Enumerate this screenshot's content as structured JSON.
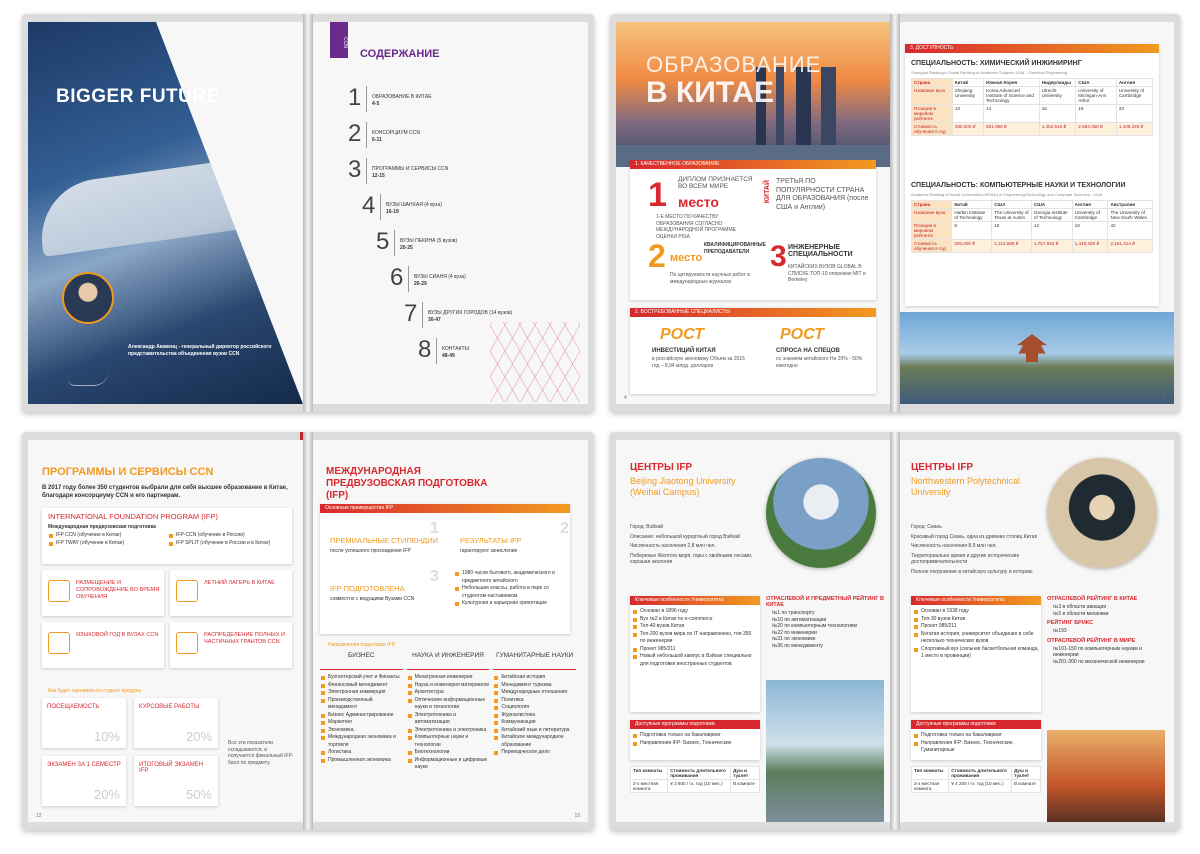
{
  "spread1": {
    "cover_title": "BIGGER FUTURE",
    "cover_small": "CCN",
    "contents_title": "СОДЕРЖАНИЕ",
    "toc": [
      {
        "n": "1",
        "title": "ОБРАЗОВАНИЕ В КИТАЕ",
        "pages": "4-5"
      },
      {
        "n": "2",
        "title": "КОНСОРЦИУМ CCN",
        "pages": "6-11"
      },
      {
        "n": "3",
        "title": "ПРОГРАММЫ И СЕРВИСЫ CCN",
        "pages": "12-15"
      },
      {
        "n": "4",
        "title": "ВУЗЫ ШАНХАЯ (4 вуза)",
        "pages": "16-19"
      },
      {
        "n": "5",
        "title": "ВУЗЫ ПЕКИНА (5 вузов)",
        "pages": "20-25"
      },
      {
        "n": "6",
        "title": "ВУЗЫ СИАНЯ (4 вуза)",
        "pages": "26-29"
      },
      {
        "n": "7",
        "title": "ВУЗЫ ДРУГИХ ГОРОДОВ (14 вузов)",
        "pages": "30-47"
      },
      {
        "n": "8",
        "title": "КОНТАКТЫ",
        "pages": "48-49"
      }
    ],
    "author": "Александр Акавенц - генеральный директор российского представительства объединения вузов CCN"
  },
  "spread2": {
    "hero_line1": "ОБРАЗОВАНИЕ",
    "hero_line2": "В КИТАЕ",
    "sec1": "1. КАЧЕСТВЕННОЕ ОБРАЗОВАНИЕ",
    "f1_big": "1",
    "f1_word": "место",
    "f1_top": "ДИПЛОМ ПРИЗНАЕТСЯ ВО ВСЕМ МИРЕ",
    "f1_sub": "1-Е МЕСТО ПО КАЧЕСТВУ ОБРАЗОВАНИЯ СОГЛАСНО МЕЖДУНАРОДНОЙ ПРОГРАММЕ ОЦЕНКИ PISA",
    "f2_side": "КИТАЙ",
    "f2_text": "ТРЕТЬЯ ПО ПОПУЛЯРНОСТИ СТРАНА ДЛЯ ОБРАЗОВАНИЯ (после США и Англии)",
    "f3_big": "2",
    "f3_word": "место",
    "f3_top": "КВАЛИФИЦИРОВАННЫЕ ПРЕПОДАВАТЕЛИ",
    "f3_sub": "По цитируемости научных работ в международных журналах",
    "f4_big": "3",
    "f4_top": "ИНЖЕНЕРНЫЕ СПЕЦИАЛЬНОСТИ",
    "f4_sub": "КИТАЙСКИХ ВУЗОВ GLOBAL В СПИСКЕ ТОП-10 опережая MIT и Berkeley",
    "sec2": "2. ВОСТРЕБОВАННЫЕ СПЕЦИАЛИСТЫ",
    "g1_big": "РОСТ",
    "g1_title": "ИНВЕСТИЦИЙ КИТАЯ",
    "g1_sub": "в российскую экономику Объем за 2015 год – 8,94 млрд. долларов",
    "g2_big": "РОСТ",
    "g2_title": "СПРОСА НА СПЕЦОВ",
    "g2_sub": "со знанием китайского На 20% - 50% ежегодно",
    "sec3": "3. ДОСТУПНОСТЬ",
    "t1_title": "СПЕЦИАЛЬНОСТЬ: ХИМИЧЕСКИЙ ИНЖИНИРИНГ",
    "t1_src": "Shanghai Ranking's Global Ranking of Academic Subjects 2016 - Chemical Engineering",
    "t1_head": [
      "Страна",
      "Китай",
      "Южная Корея",
      "Нидерланды",
      "США",
      "Англия"
    ],
    "t1_rows": [
      [
        "Название вуза",
        "Zhejiang University",
        "Korea Advanced Institute of Science and Technology",
        "Utrecht University",
        "University of Michigan-Ann Arbor",
        "University of Cambridge"
      ],
      [
        "Позиция в мировом рейтинге",
        "13",
        "14",
        "16",
        "19",
        "23"
      ],
      [
        "Стоимость обучения в год",
        "280,000 ₽",
        "501,966 ₽",
        "1,452,519 ₽",
        "2,693,358 ₽",
        "1,449,329 ₽"
      ]
    ],
    "t2_title": "СПЕЦИАЛЬНОСТЬ: КОМПЬЮТЕРНЫЕ НАУКИ И ТЕХНОЛОГИИ",
    "t2_src": "Academic Ranking of World Universities (ARWU) in Engineering/Technology and Computer Sciences - 2016",
    "t2_head": [
      "Страна",
      "Китай",
      "США",
      "США",
      "Англия",
      "Австралия"
    ],
    "t2_rows": [
      [
        "Название вуза",
        "Harbin Institute of Technology",
        "The University of Texas at Austin",
        "Georgia Institute of Technology",
        "University of Cambridge",
        "The University of New South Wales"
      ],
      [
        "Позиция в мировом рейтинге",
        "9",
        "10",
        "12",
        "19",
        "42"
      ],
      [
        "Стоимость обучения в год",
        "200,000 ₽",
        "2,112,966 ₽",
        "1,757,993 ₽",
        "1,449,329 ₽",
        "2,161,414 ₽"
      ]
    ],
    "page_left": "4",
    "page_right": "5"
  },
  "spread3": {
    "title": "ПРОГРАММЫ И СЕРВИСЫ CCN",
    "intro": "В 2017 году более 350 студентов выбрали для себя высшее образование в Китае, благодаря консорциуму CCN и его партнерам.",
    "ifp_title": "INTERNATIONAL FOUNDATION PROGRAM (IFP)",
    "ifp_sub": "Международная предвузовская подготовка",
    "ifp_items": [
      "IFP CCN (обучение в Китае)",
      "IFP-CCN (обучение в России)",
      "IFP TWAY (обучение в Китае)",
      "IFP SPLIT (обучение в России и в Китае)"
    ],
    "svc": [
      "РАЗМЕЩЕНИЕ И СОПРОВОЖДЕНИЕ ВО ВРЕМЯ ОБУЧЕНИЯ",
      "ЛЕТНИЙ ЛАГЕРЬ В КИТАЕ",
      "ЯЗЫКОВОЙ ГОД В ВУЗАХ CCN",
      "РАСПРЕДЕЛЕНИЕ ПОЛНЫХ И ЧАСТИЧНЫХ ГРАНТОВ CCN"
    ],
    "grade_q": "Как будет оцениваться студент предузы",
    "grades": [
      {
        "label": "ПОСЕЩАЕМОСТЬ",
        "pct": "10%"
      },
      {
        "label": "КУРСОВЫЕ РАБОТЫ",
        "pct": "20%"
      },
      {
        "label": "ЭКЗАМЕН ЗА 1 СЕМЕСТР",
        "pct": "20%"
      },
      {
        "label": "ИТОГОВЫЙ ЭКЗАМЕН IFP",
        "pct": "50%"
      }
    ],
    "grade_note": "Все эти показатели складываются, и получается финальный IFP-балл по предмету.",
    "r_title": "МЕЖДУНАРОДНАЯ ПРЕДВУЗОВСКАЯ ПОДГОТОВКА (IFP)",
    "adv_bar": "Основные преимущества IFP",
    "adv": [
      {
        "n": "1",
        "t": "ПРЕМИАЛЬНЫЕ СТИПЕНДИИ",
        "s": "после успешного прохождения IFP"
      },
      {
        "n": "2",
        "t": "РЕЗУЛЬТАТЫ IFP",
        "s": "гарантируют зачисление"
      },
      {
        "n": "3",
        "t": "IFP ПОДГОТОВЛЕНА",
        "s": "совместно с ведущими Вузами CCN"
      }
    ],
    "adv_list": [
      "1080 часов бытового, академического и предметного китайского",
      "Небольшие классы, работа в паре со студентом-наставником",
      "Культурная и карьерная ориентация"
    ],
    "dir_label": "Направления подготовки IFP",
    "cols": [
      {
        "h": "БИЗНЕС",
        "items": [
          "Бухгалтерский учет и Финансы",
          "Финансовый менеджмент",
          "Электронная коммерция",
          "Производственный менеджмент",
          "Бизнес Администрирование",
          "Маркетинг",
          "Экономика",
          "Международная экономика и торговля",
          "Логистика",
          "Промышленная экономика"
        ]
      },
      {
        "h": "НАУКА И ИНЖЕНЕРИЯ",
        "items": [
          "Мехатронная инженерия",
          "Наука и инженерия материалов",
          "Архитектура",
          "Оптические информационные науки и технологии",
          "Электротехника и автоматизация",
          "Электротехника и электроника",
          "Компьютерные науки и технологии",
          "Биотехнологии",
          "Информационные и цифровые науки"
        ]
      },
      {
        "h": "ГУМАНИТАРНЫЕ НАУКИ",
        "items": [
          "Китайская история",
          "Менеджмент туризма",
          "Международные отношения",
          "Политика",
          "Социология",
          "Журналистика",
          "Коммуникации",
          "Китайский язык и литература",
          "Китайское международное образование",
          "Переводческое дело"
        ]
      }
    ],
    "page_left": "12",
    "page_right": "13"
  },
  "spread4": {
    "left": {
      "title": "ЦЕНТРЫ IFP",
      "uni": "Beijing Jiaotong University (Weihai Campus)",
      "facts": [
        "Город: Вэйхай",
        "Описание: небольшой курортный город Вэйхай",
        "Численность населения 2,8 млн чел.",
        "Побережье Желтого моря, горы с хвойными лесами, хорошая экология"
      ],
      "feat_bar": "Ключевые особенности Университета:",
      "features": [
        "Основан в 1896 году",
        "Вуз №2 в Китае по e-commerce",
        "Топ-40 вузов Китая",
        "Топ-200 вузов мира по IT направлению, топ-350 по инженерии",
        "Проект 985/211",
        "Новый небольшой кампус в Вэйхае специально для подготовки иностранных студентов"
      ],
      "rank_title": "ОТРАСЛЕВОЙ И ПРЕДМЕТНЫЙ РЕЙТИНГ В КИТАЕ",
      "ranks": [
        "№1 по транспорту",
        "№10 по автоматизации",
        "№20 по компьютерным технологиям",
        "№22 по инженерии",
        "№31 по экономике",
        "№36 по менеджменту"
      ],
      "prog_bar": "Доступные программы подготовки",
      "progs": [
        "Подготовка только на бакалавриат",
        "Направления IFP: Бизнес, Технические"
      ],
      "table_head": [
        "Тип комнаты",
        "Стоимость длительного проживания",
        "Душ и туалет"
      ],
      "table_row": [
        "2-х местная комната",
        "¥ 3 600 / гх. год (10 мес.)",
        "В комнате"
      ],
      "photo_caption": "Вэйхай"
    },
    "right": {
      "title": "ЦЕНТРЫ IFP",
      "uni": "Northwestern Polytechnical University",
      "facts": [
        "Город: Сиань",
        "Красивый город Сиань, одна из древних столиц Китая",
        "Численность населения 8,9 млн чел.",
        "Территориально армия и другие исторические достопримечательности",
        "Полное погружение в китайскую культуру и историю"
      ],
      "feat_bar": "Ключевые особенности Университета:",
      "features": [
        "Основан в 1938 году",
        "Топ-30 вузов Китая",
        "Проект 985/211",
        "Богатая история, университет объединил в себе несколько технических вузов",
        "Спортивный вуз (сильная баскетбольная команда, 1 место в провинции)"
      ],
      "rank_title": "ОТРАСЛЕВОЙ РЕЙТИНГ В КИТАЕ",
      "ranks": [
        "№3 в области авиации",
        "№5 в области механики"
      ],
      "brics_title": "РЕЙТИНГ БРИКС",
      "brics": [
        "№193"
      ],
      "world_title": "ОТРАСЛЕВОЙ РЕЙТИНГ В МИРЕ",
      "world": [
        "№101-150 по компьютерным наукам и инженерии",
        "№201-300 по механической инженерии"
      ],
      "prog_bar": "Доступные программы подготовки",
      "progs": [
        "Подготовка только на бакалавриат",
        "Направления IFP: Бизнес, Технические, Гуманитарные"
      ],
      "table_head": [
        "Тип комнаты",
        "Стоимость длительного проживания",
        "Душ и туалет"
      ],
      "table_row": [
        "2-х местная комната",
        "¥ 4 200 / гх. год (10 мес.)",
        "В комнате"
      ]
    }
  },
  "colors": {
    "orange": "#f29a1f",
    "red": "#d7282f",
    "purple": "#6a2a8c",
    "navy": "#1c3158"
  }
}
